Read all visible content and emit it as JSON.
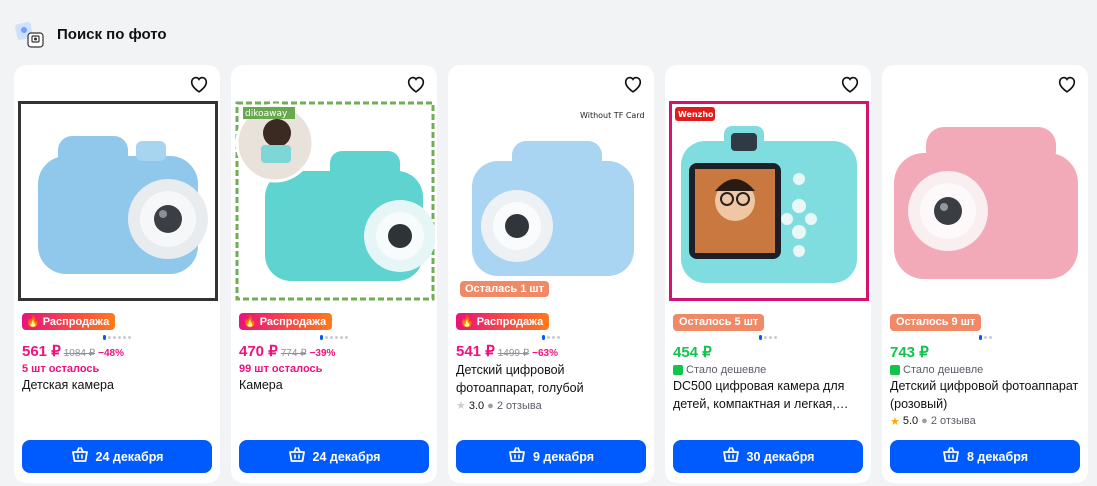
{
  "header": {
    "title": "Поиск по фото"
  },
  "sale_label": "Распродажа",
  "cheaper_label": "Стало дешевле",
  "colors": {
    "accent": "#005bff",
    "sale_pink": "#f1117e",
    "cheaper_green": "#10c44c",
    "stock_orange": "#f08a66"
  },
  "products": [
    {
      "price": "561 ₽",
      "old_price": "1084 ₽",
      "discount": "−48%",
      "stock_left": "5 шт осталось",
      "name": "Детская камера",
      "delivery": "24 декабря",
      "image_label": ""
    },
    {
      "price": "470 ₽",
      "old_price": "774 ₽",
      "discount": "−39%",
      "stock_left": "99 шт осталось",
      "name": "Камера",
      "delivery": "24 декабря",
      "image_label": "dikoaway"
    },
    {
      "price": "541 ₽",
      "old_price": "1499 ₽",
      "discount": "−63%",
      "stock_badge": "Осталась 1 шт",
      "name": "Детский цифровой фотоаппарат, голубой",
      "rating": "3.0",
      "reviews": "2 отзыва",
      "delivery": "9 декабря",
      "image_label": "Without TF Card"
    },
    {
      "price": "454 ₽",
      "stock_badge": "Осталось 5 шт",
      "name": "DC500 цифровая камера для детей, компактная и легкая, дл...",
      "delivery": "30 декабря",
      "image_label": "Wenzho"
    },
    {
      "price": "743 ₽",
      "stock_badge": "Осталось 9 шт",
      "name": "Детский цифровой фотоаппарат (розовый)",
      "rating": "5.0",
      "reviews": "2 отзыва",
      "delivery": "8 декабря",
      "image_label": ""
    }
  ]
}
